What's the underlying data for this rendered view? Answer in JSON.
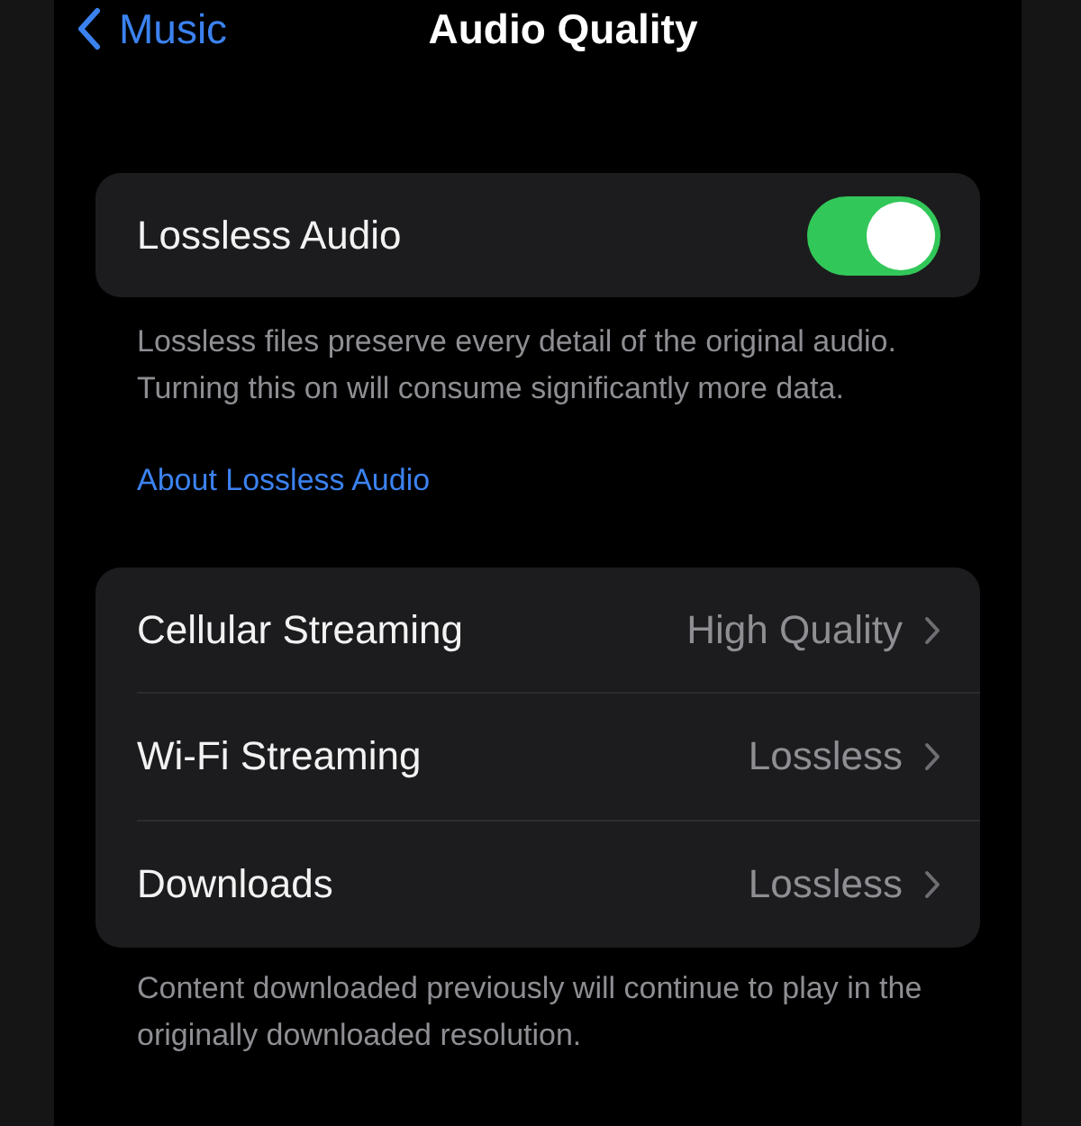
{
  "nav": {
    "back_label": "Music",
    "title": "Audio Quality"
  },
  "lossless": {
    "label": "Lossless Audio",
    "on": true
  },
  "lossless_note": "Lossless files preserve every detail of the original audio. Turning this on will consume significantly more data.",
  "about_link": "About Lossless Audio",
  "quality_rows": [
    {
      "label": "Cellular Streaming",
      "value": "High Quality"
    },
    {
      "label": "Wi-Fi Streaming",
      "value": "Lossless"
    },
    {
      "label": "Downloads",
      "value": "Lossless"
    }
  ],
  "downloads_note": "Content downloaded previously will continue to play in the originally downloaded resolution."
}
